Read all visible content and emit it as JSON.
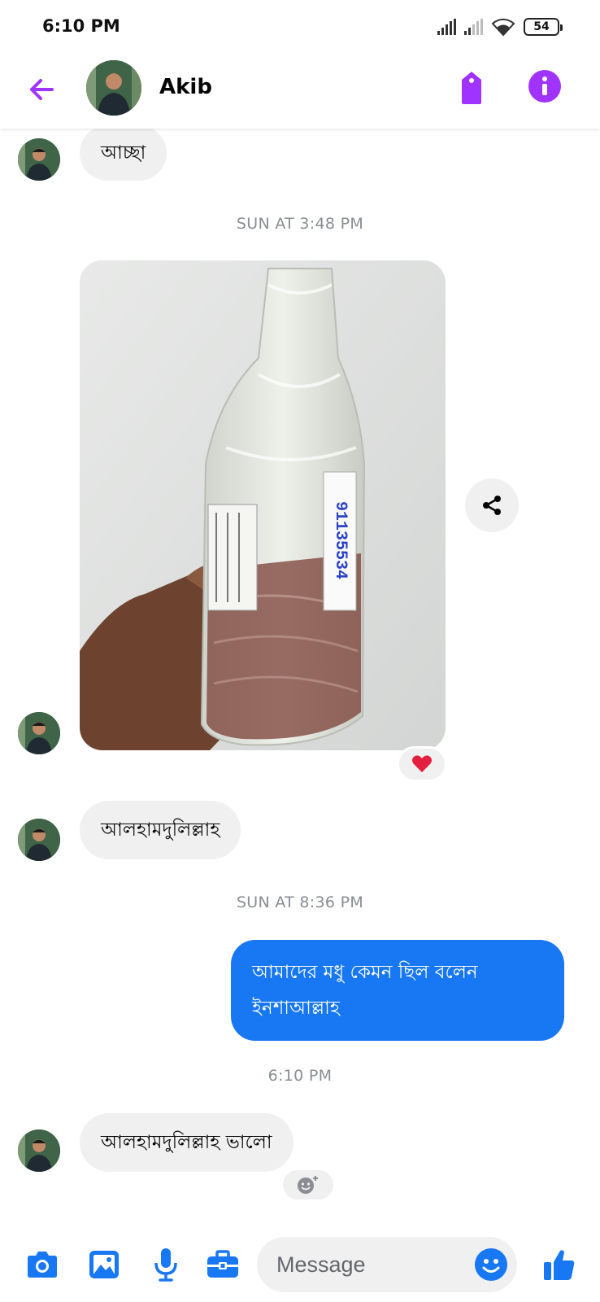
{
  "status_bar": {
    "time": "6:10 PM",
    "battery": "54"
  },
  "header": {
    "name": "Akib"
  },
  "messages": {
    "m1": "আচ্ছা",
    "ts1": "SUN AT 3:48 PM",
    "photo_label": "91135534",
    "m2": "আলহামদুলিল্লাহ",
    "ts2": "SUN AT 8:36 PM",
    "m3": "আমাদের মধু কেমন ছিল বলেন ইনশাআল্লাহ",
    "ts3": "6:10 PM",
    "m4": "আলহামদুলিল্লাহ ভালো"
  },
  "composer": {
    "placeholder": "Message"
  },
  "colors": {
    "accent_purple": "#a033ff",
    "blue": "#1877f2",
    "bubble_gray": "#f0f0f0",
    "heart": "#e41e3f"
  },
  "icons": [
    "back-arrow-icon",
    "tag-icon",
    "info-icon",
    "share-icon",
    "heart-reaction-icon",
    "add-reaction-icon",
    "camera-icon",
    "gallery-icon",
    "microphone-icon",
    "toolbox-icon",
    "emoji-icon",
    "thumbs-up-icon"
  ]
}
